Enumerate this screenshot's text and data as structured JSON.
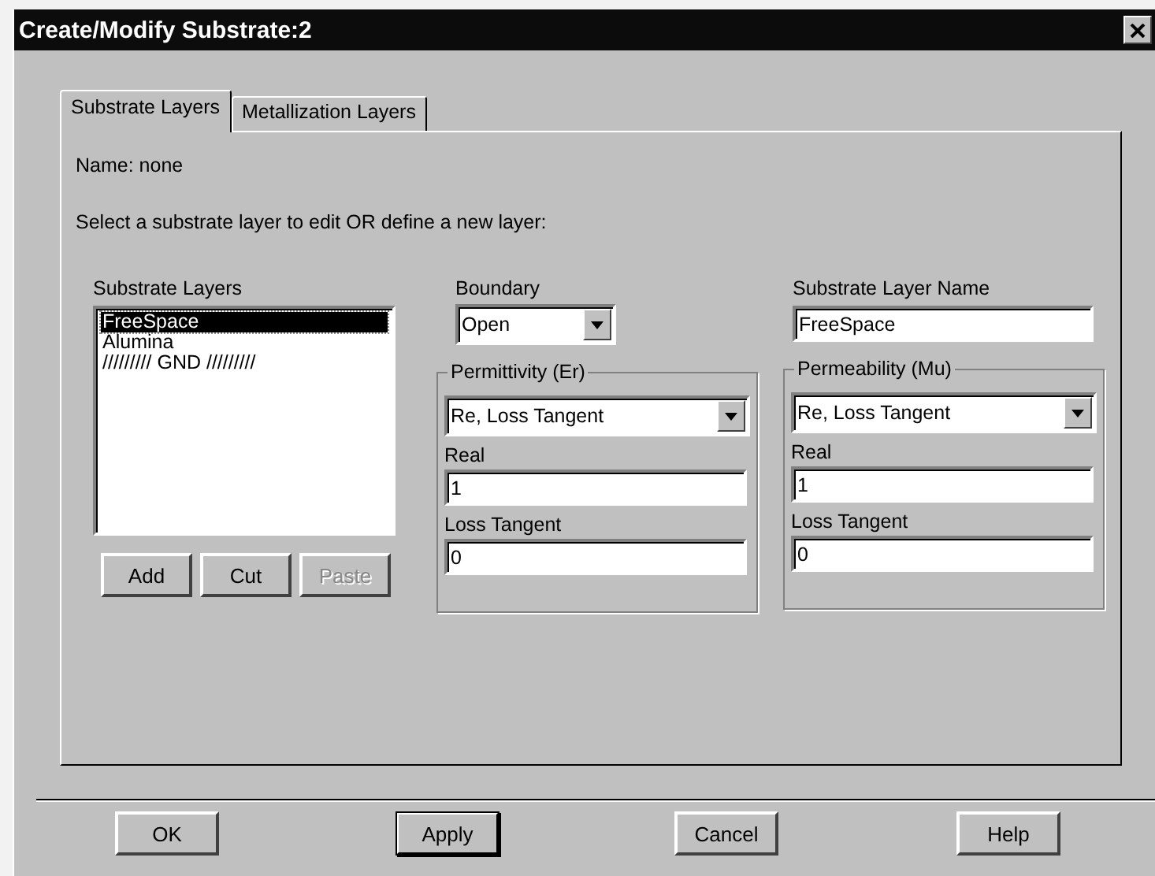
{
  "window": {
    "title": "Create/Modify Substrate:2"
  },
  "tabs": [
    {
      "label": "Substrate Layers",
      "selected": true
    },
    {
      "label": "Metallization Layers",
      "selected": false
    }
  ],
  "name_label": "Name: none",
  "instruction": "Select a substrate layer to edit OR define a new layer:",
  "substrate_layers": {
    "label": "Substrate Layers",
    "items": [
      {
        "text": "FreeSpace",
        "selected": true
      },
      {
        "text": "Alumina",
        "selected": false
      },
      {
        "text": "///////// GND /////////",
        "selected": false
      }
    ],
    "buttons": [
      {
        "label": "Add",
        "disabled": false
      },
      {
        "label": "Cut",
        "disabled": false
      },
      {
        "label": "Paste",
        "disabled": true
      }
    ]
  },
  "boundary": {
    "label": "Boundary",
    "value": "Open"
  },
  "layer_name": {
    "label": "Substrate Layer Name",
    "value": "FreeSpace"
  },
  "groups": [
    {
      "title": "Permittivity (Er)",
      "mode": "Re, Loss Tangent",
      "real_label": "Real",
      "real": "1",
      "loss_label": "Loss Tangent",
      "loss": "0"
    },
    {
      "title": "Permeability (Mu)",
      "mode": "Re, Loss Tangent",
      "real_label": "Real",
      "real": "1",
      "loss_label": "Loss Tangent",
      "loss": "0"
    }
  ],
  "footer_buttons": [
    {
      "label": "OK",
      "default": false
    },
    {
      "label": "Apply",
      "default": true
    },
    {
      "label": "Cancel",
      "default": false
    },
    {
      "label": "Help",
      "default": false
    }
  ]
}
